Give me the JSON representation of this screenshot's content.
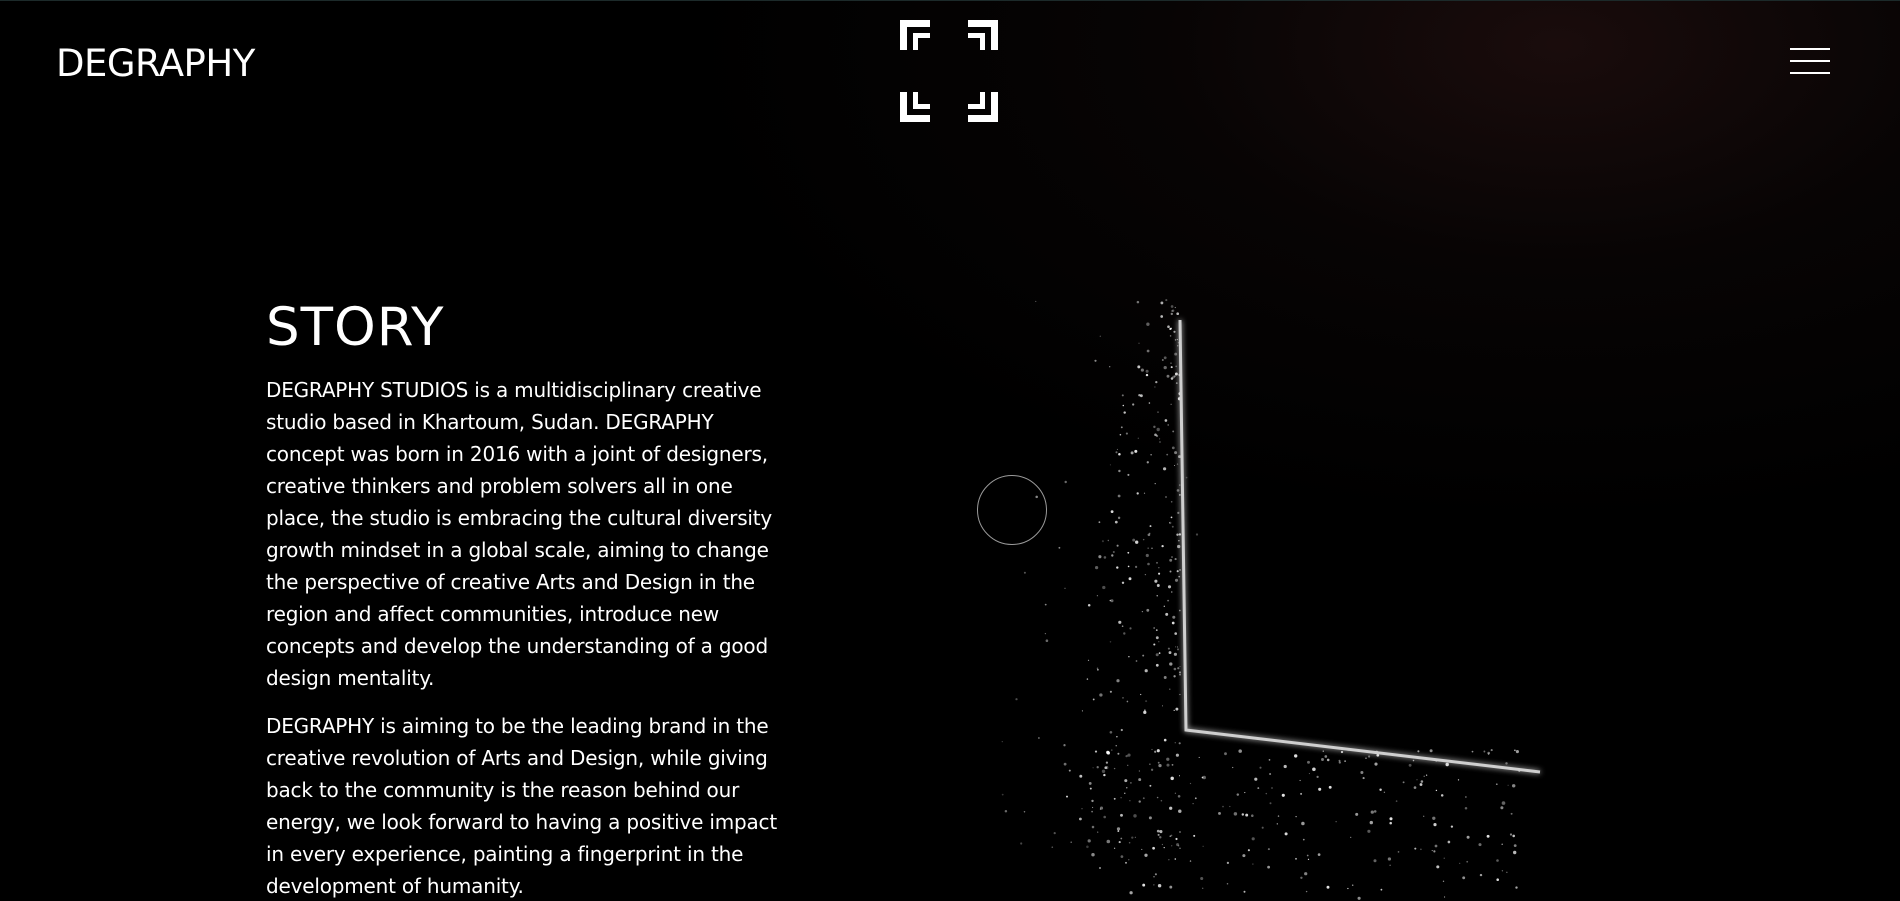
{
  "header": {
    "brand": "DEGRAPHY",
    "logo_icon": "degraphy-brackets-logo-icon",
    "menu_icon": "hamburger-menu-icon"
  },
  "story": {
    "title": "STORY",
    "paragraphs": [
      "DEGRAPHY STUDIOS is a multidisciplinary creative studio based in Khartoum, Sudan. DEGRAPHY concept was born in 2016 with a joint of designers, creative thinkers and problem solvers all in one place, the studio is embracing the cultural diversity growth mindset in a global scale, aiming to change the perspective of creative Arts and Design in the region and affect communities, introduce new concepts and develop the understanding of a good design mentality.",
      "DEGRAPHY is aiming to be the leading brand in the creative revolution of Arts and Design, while giving back to the community is the reason behind our energy, we look forward to having a positive impact in every experience, painting a fingerprint in the development of humanity."
    ]
  },
  "colors": {
    "background": "#000000",
    "text": "#ffffff",
    "ring": "#9a9a9a"
  }
}
